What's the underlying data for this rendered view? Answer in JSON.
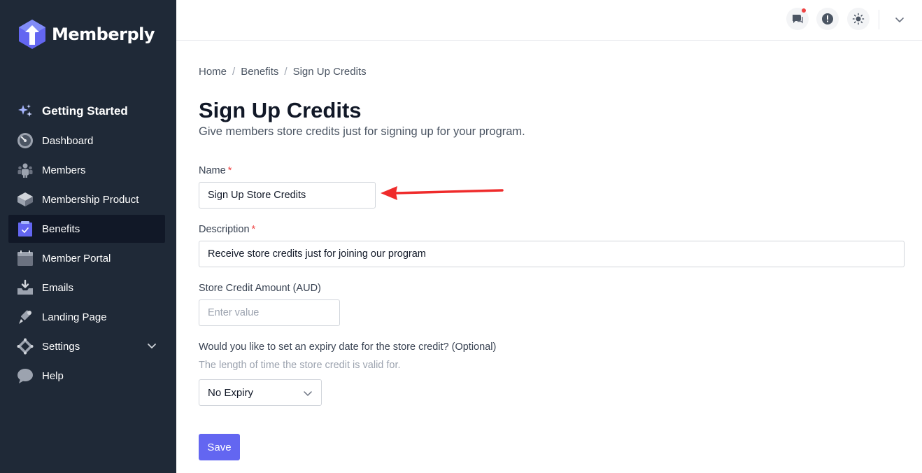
{
  "brand": {
    "name": "Memberply",
    "accent": "#6366f1",
    "sidebar_bg": "#1f2937"
  },
  "sidebar": {
    "items": [
      {
        "label": "Getting Started",
        "icon": "sparkles-icon"
      },
      {
        "label": "Dashboard",
        "icon": "gauge-icon"
      },
      {
        "label": "Members",
        "icon": "users-icon"
      },
      {
        "label": "Membership Product",
        "icon": "cube-icon"
      },
      {
        "label": "Benefits",
        "icon": "clipboard-check-icon",
        "active": true
      },
      {
        "label": "Member Portal",
        "icon": "calendar-icon"
      },
      {
        "label": "Emails",
        "icon": "inbox-icon"
      },
      {
        "label": "Landing Page",
        "icon": "pen-icon"
      },
      {
        "label": "Settings",
        "icon": "settings-icon"
      },
      {
        "label": "Help",
        "icon": "chat-bubble-icon"
      }
    ]
  },
  "topbar": {
    "icons": [
      "chat-icon",
      "alert-icon",
      "sun-icon",
      "chevron-down-icon"
    ]
  },
  "breadcrumb": [
    "Home",
    "Benefits",
    "Sign Up Credits"
  ],
  "page": {
    "title": "Sign Up Credits",
    "subtitle": "Give members store credits just for signing up for your program."
  },
  "form": {
    "name_label": "Name",
    "name_required": "*",
    "name_value": "Sign Up Store Credits",
    "description_label": "Description",
    "description_required": "*",
    "description_value": "Receive store credits just for joining our program",
    "amount_label": "Store Credit Amount (AUD)",
    "amount_placeholder": "Enter value",
    "expiry_label": "Would you like to set an expiry date for the store credit? (Optional)",
    "expiry_help": "The length of time the store credit is valid for.",
    "expiry_value": "No Expiry",
    "save_label": "Save"
  },
  "annotation": {
    "arrow_color": "#ef2b2b",
    "arrow_icon": "red-arrow-icon"
  }
}
